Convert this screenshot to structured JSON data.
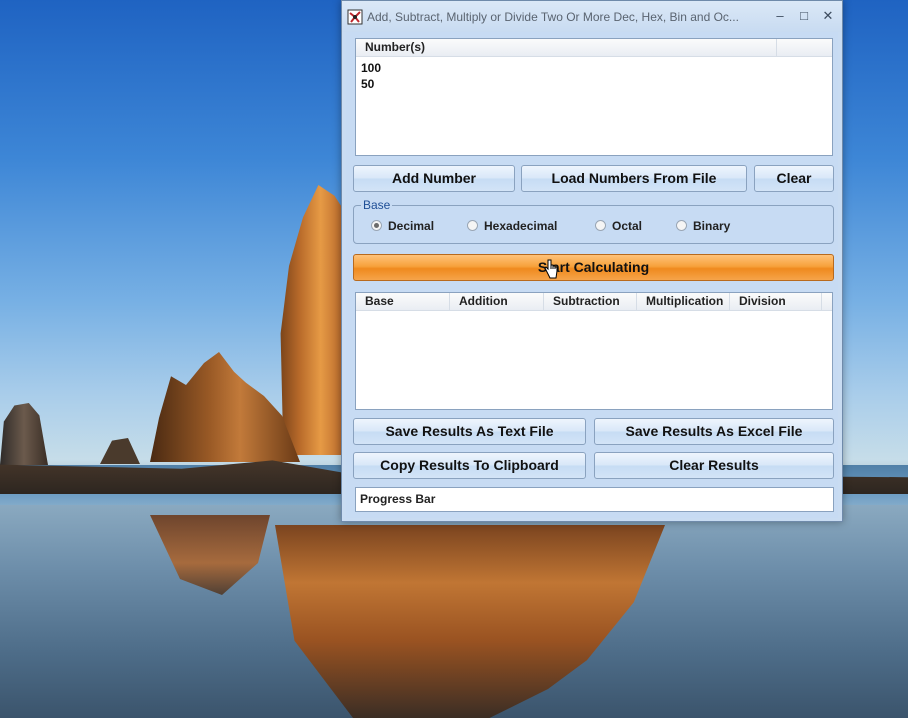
{
  "window": {
    "title": "Add, Subtract, Multiply or Divide Two Or More Dec, Hex, Bin and Oc...",
    "minimize": "–",
    "maximize": "□",
    "close": "✕"
  },
  "numbers": {
    "header": "Number(s)",
    "items": [
      "100",
      "50"
    ]
  },
  "buttons": {
    "add_number": "Add Number",
    "load_numbers": "Load Numbers From File",
    "clear": "Clear",
    "start": "Start Calculating",
    "save_text": "Save Results As Text File",
    "save_excel": "Save Results As Excel File",
    "copy_clipboard": "Copy Results To Clipboard",
    "clear_results": "Clear Results"
  },
  "base": {
    "label": "Base",
    "options": [
      "Decimal",
      "Hexadecimal",
      "Octal",
      "Binary"
    ],
    "selected": "Decimal"
  },
  "results": {
    "columns": [
      "Base",
      "Addition",
      "Subtraction",
      "Multiplication",
      "Division"
    ]
  },
  "progress": {
    "label": "Progress Bar"
  },
  "colors": {
    "start_button": "#f39a2e",
    "window_bg": "#c7dbf3",
    "group_label": "#1e4e96"
  }
}
